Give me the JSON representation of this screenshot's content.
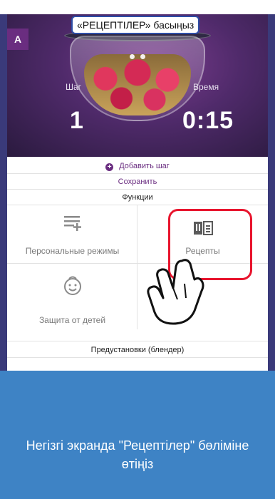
{
  "callout": {
    "text": "«РЕЦЕПТІЛЕР» басыңыз"
  },
  "badge": {
    "label": "A"
  },
  "hero": {
    "step_label": "Шаг",
    "step_value": "1",
    "time_label": "Время",
    "time_value": "0:15",
    "page_dots": 2
  },
  "list": {
    "add_step": "Добавить шаг",
    "save": "Сохранить",
    "functions": "Функции",
    "presets": "Предустановки (блендер)"
  },
  "tiles": {
    "personal_modes": "Персональные режимы",
    "recipes": "Рецепты",
    "child_lock": "Защита от детей"
  },
  "instruction": {
    "text": "Негізгі экранда \"Рецептілер\" бөліміне өтіңіз"
  },
  "colors": {
    "accent_purple": "#6a2d80",
    "highlight_red": "#e8152e",
    "info_blue": "#3e83c5",
    "callout_border": "#2d4ea6"
  },
  "icons": {
    "add": "plus-circle-icon",
    "personal_modes": "list-add-icon",
    "recipes": "recipe-book-icon",
    "child_lock": "child-face-icon",
    "pointer": "pointing-hand-icon"
  }
}
